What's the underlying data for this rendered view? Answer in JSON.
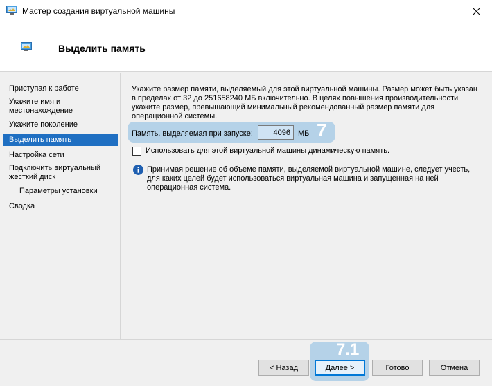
{
  "window": {
    "title": "Мастер создания виртуальной машины",
    "close_glyph": "✕"
  },
  "header": {
    "title": "Выделить память"
  },
  "sidebar": {
    "steps": [
      {
        "label": "Приступая к работе"
      },
      {
        "label": "Укажите имя и местонахождение"
      },
      {
        "label": "Укажите поколение"
      },
      {
        "label": "Выделить память",
        "active": true
      },
      {
        "label": "Настройка сети"
      },
      {
        "label": "Подключить виртуальный жесткий диск"
      },
      {
        "label": "Параметры установки"
      },
      {
        "label": "Сводка"
      }
    ]
  },
  "content": {
    "description": "Укажите размер памяти, выделяемый для этой виртуальной машины. Размер может быть указан в пределах от 32 до 251658240 МБ включительно. В целях повышения производительности укажите размер, превышающий минимальный рекомендованный размер памяти для операционной системы.",
    "memory_label": "Память, выделяемая при запуске:",
    "memory_value": "4096",
    "memory_unit": "МБ",
    "dynamic_memory_label": "Использовать для этой виртуальной машины динамическую память.",
    "dynamic_memory_checked": false,
    "info_text": "Принимая решение об объеме памяти, выделяемой виртуальной машине, следует учесть, для каких целей будет использоваться виртуальная машина и запущенная на ней операционная система.",
    "step_badge": "7"
  },
  "footer": {
    "back_label": "< Назад",
    "next_label": "Далее >",
    "finish_label": "Готово",
    "cancel_label": "Отмена",
    "step_badge": "7.1"
  },
  "colors": {
    "accent": "#1f6fc2",
    "highlight": "#b5d2e8",
    "info_icon": "#1f5fb0"
  },
  "icons": {
    "app": "hyper-v-vm-icon",
    "close": "close-icon",
    "info": "info-icon"
  }
}
